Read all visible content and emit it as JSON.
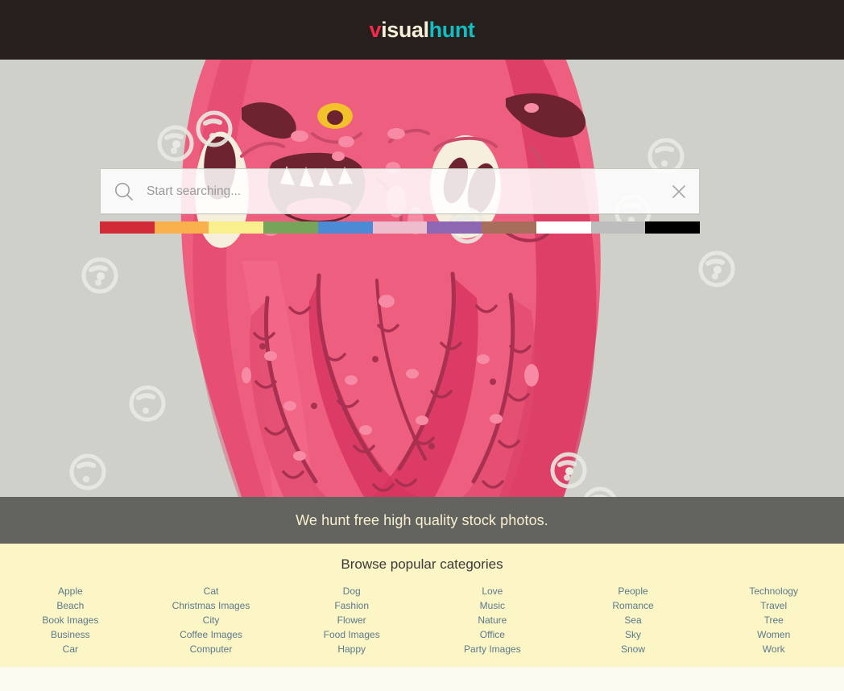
{
  "header": {
    "logo": {
      "part1": "v",
      "part2": "isual",
      "part3": "hunt"
    },
    "logo_colors": {
      "v": "#f7294e",
      "isual": "#f6efd9",
      "hunt": "#0fbfc4"
    },
    "background": "#271f1c"
  },
  "hero": {
    "background": "#cfd0c9",
    "illustration": "pink-monster-with-tentacles",
    "search": {
      "placeholder": "Start searching...",
      "value": "",
      "search_icon": "search-icon",
      "clear_icon": "close-icon"
    },
    "color_filters": [
      {
        "name": "red",
        "hex": "#d22b38"
      },
      {
        "name": "orange",
        "hex": "#f9b04d"
      },
      {
        "name": "yellow",
        "hex": "#faef8d"
      },
      {
        "name": "green",
        "hex": "#76a55a"
      },
      {
        "name": "blue",
        "hex": "#4b8bd6"
      },
      {
        "name": "pink",
        "hex": "#eebdcd"
      },
      {
        "name": "purple",
        "hex": "#8e67b3"
      },
      {
        "name": "brown",
        "hex": "#a86e5c"
      },
      {
        "name": "white",
        "hex": "#ffffff"
      },
      {
        "name": "gray",
        "hex": "#bdbdbd"
      },
      {
        "name": "black",
        "hex": "#000000"
      }
    ]
  },
  "tagline": {
    "text": "We hunt free high quality stock photos."
  },
  "categories": {
    "title": "Browse popular categories",
    "background": "#fcf5c6",
    "link_color": "#5a7a8a",
    "columns": [
      {
        "items": [
          "Apple",
          "Beach",
          "Book Images",
          "Business",
          "Car"
        ]
      },
      {
        "items": [
          "Cat",
          "Christmas Images",
          "City",
          "Coffee Images",
          "Computer"
        ]
      },
      {
        "items": [
          "Dog",
          "Fashion",
          "Flower",
          "Food Images",
          "Happy"
        ]
      },
      {
        "items": [
          "Love",
          "Music",
          "Nature",
          "Office",
          "Party Images"
        ]
      },
      {
        "items": [
          "People",
          "Romance",
          "Sea",
          "Sky",
          "Snow"
        ]
      },
      {
        "items": [
          "Technology",
          "Travel",
          "Tree",
          "Women",
          "Work"
        ]
      }
    ]
  }
}
